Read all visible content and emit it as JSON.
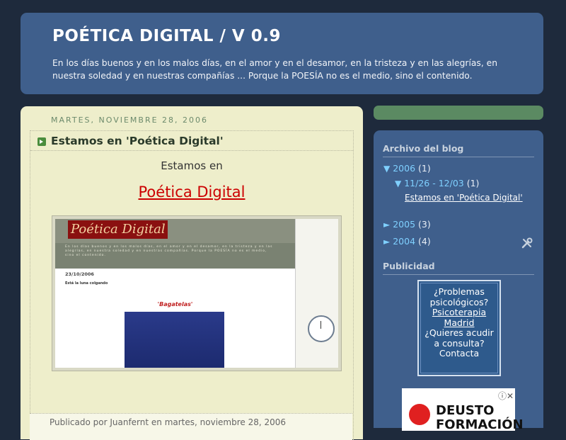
{
  "header": {
    "title": "POÉTICA DIGITAL / V 0.9",
    "description": "En los días buenos y en los malos días, en el amor y en el desamor, en la tristeza y en las alegrías, en nuestra soledad y en nuestras compañías ... Porque la POESÍA no es el medio, sino el contenido."
  },
  "post": {
    "date": "MARTES, NOVIEMBRE 28, 2006",
    "title": "Estamos en 'Poética Digital'",
    "line1": "Estamos en",
    "link": "Poética Digital",
    "footer": "Publicado por Juanfernt en martes, noviembre 28, 2006"
  },
  "screenshot_preview": {
    "title": "Poética Digital",
    "band_text": "En los días buenos y en los malos días, en el amor y en el desamor, en la tristeza y en las alegrías, en nuestra soledad y en nuestras compañías. Porque la POESÍA no es el medio, sino el contenido.",
    "date": "23/10/2006",
    "subtitle": "Está la luna colgando",
    "red_title": "'Bagatelas'"
  },
  "sidebar": {
    "archive_heading": "Archivo del blog",
    "archive": [
      {
        "year": "2006",
        "count": "(1)",
        "expanded": true
      },
      {
        "range": "11/26 - 12/03",
        "count": "(1)"
      },
      {
        "post": "Estamos en 'Poética Digital'"
      },
      {
        "year": "2005",
        "count": "(3)",
        "expanded": false
      },
      {
        "year": "2004",
        "count": "(4)",
        "expanded": false
      }
    ],
    "ads_heading": "Publicidad",
    "ad": {
      "line1": "¿Problemas psicológicos?",
      "link": "Psicoterapia Madrid",
      "line2": "¿Quieres acudir a consulta?",
      "link2": "Contacta"
    },
    "ad2": {
      "text": "DEUSTO FORMACIÓN"
    }
  },
  "colors": {
    "background": "#1e2a3c",
    "header": "#3f5f8c",
    "main": "#eeeecb",
    "link_red": "#cc0000",
    "sidebar_accent": "#7fd0ff"
  }
}
